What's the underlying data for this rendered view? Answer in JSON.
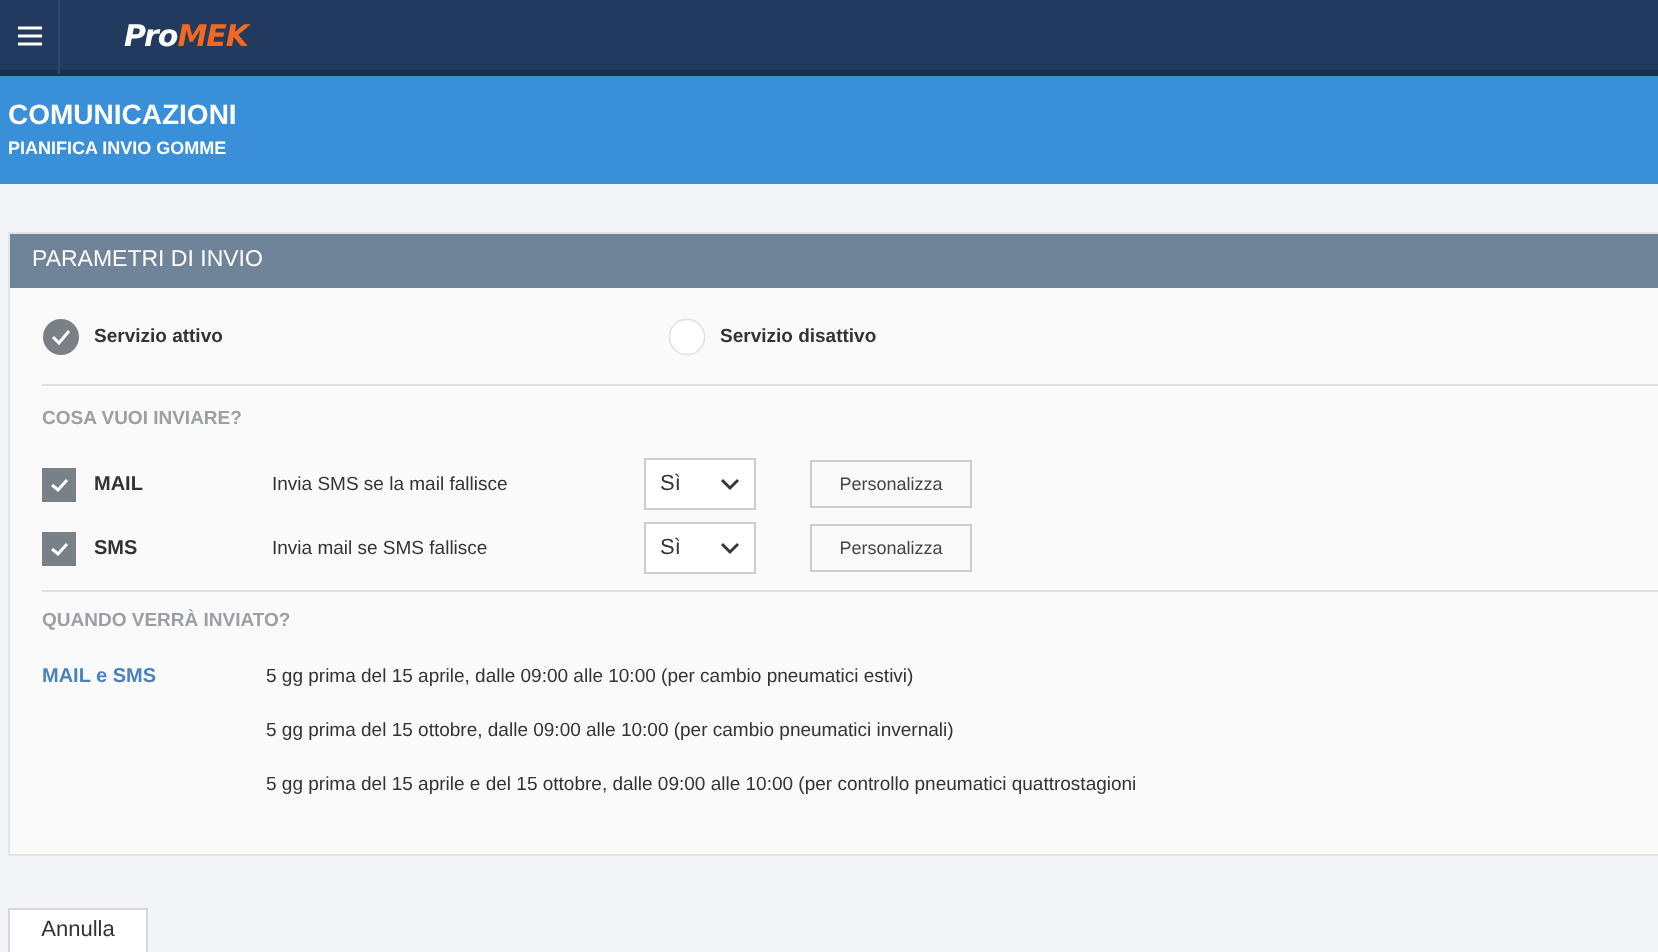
{
  "topbar": {
    "logo": {
      "part_1": "Pro",
      "part_2": "MEK"
    }
  },
  "page": {
    "title": "COMUNICAZIONI",
    "subtitle": "PIANIFICA INVIO GOMME"
  },
  "panel": {
    "title": "PARAMETRI DI INVIO",
    "service_options": [
      {
        "label": "Servizio attivo",
        "selected": true
      },
      {
        "label": "Servizio disattivo",
        "selected": false
      }
    ],
    "send_section": {
      "heading": "COSA VUOI INVIARE?",
      "channels": [
        {
          "name": "MAIL",
          "checked": true,
          "fallback": "Invia SMS se la mail fallisce",
          "choice": "Sì",
          "button": "Personalizza"
        },
        {
          "name": "SMS",
          "checked": true,
          "fallback": "Invia mail se SMS fallisce",
          "choice": "Sì",
          "button": "Personalizza"
        }
      ]
    },
    "schedule_section": {
      "heading": "QUANDO VERRÀ INVIATO?",
      "label": "MAIL e SMS",
      "lines": [
        "5 gg prima del 15 aprile, dalle 09:00 alle 10:00 (per cambio pneumatici estivi)",
        "5 gg prima del 15 ottobre, dalle 09:00 alle 10:00 (per cambio pneumatici invernali)",
        "5 gg prima del 15 aprile e del 15 ottobre, dalle 09:00 alle 10:00 (per controllo pneumatici quattrostagioni"
      ]
    }
  },
  "buttons": [
    "Annulla"
  ]
}
